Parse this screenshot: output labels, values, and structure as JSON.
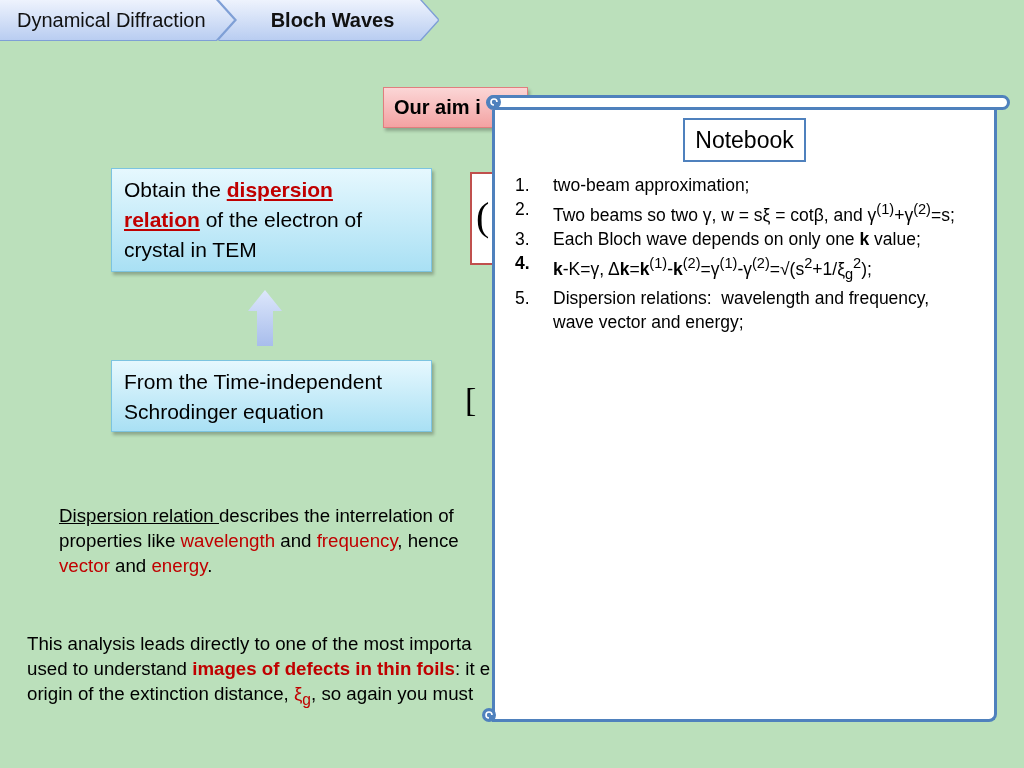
{
  "breadcrumb": [
    {
      "label": "Dynamical Diffraction",
      "selected": false
    },
    {
      "label": "Bloch Waves",
      "selected": true
    }
  ],
  "aim_box": {
    "text": "Our aim i"
  },
  "flow": {
    "goal": {
      "runs": [
        {
          "kind": "plain",
          "text": "Obtain the "
        },
        {
          "kind": "term",
          "text": "dispersion relation"
        },
        {
          "kind": "plain",
          "text": " of the electron of crystal in TEM"
        }
      ]
    },
    "source": {
      "text": "From the Time-independent Schrodinger equation"
    }
  },
  "equations": [
    {
      "kind": "boxed",
      "text": "("
    },
    {
      "kind": "plain",
      "text": "["
    }
  ],
  "paragraphs": [
    {
      "kind": "indented",
      "lines": [
        [
          {
            "kind": "underlined",
            "text": "Dispersion relation "
          },
          {
            "kind": "plain",
            "text": "describes the interrelation of"
          }
        ],
        [
          {
            "kind": "plain",
            "text": "properties like "
          },
          {
            "kind": "highlight",
            "text": "wavelength"
          },
          {
            "kind": "plain",
            "text": " and "
          },
          {
            "kind": "highlight",
            "text": "frequency"
          },
          {
            "kind": "plain",
            "text": ", hence"
          }
        ],
        [
          {
            "kind": "highlight",
            "text": "vector"
          },
          {
            "kind": "plain",
            "text": " and "
          },
          {
            "kind": "highlight",
            "text": "energy"
          },
          {
            "kind": "plain",
            "text": "."
          }
        ]
      ]
    },
    {
      "kind": "flush",
      "lines": [
        [
          {
            "kind": "plain",
            "text": "This analysis leads directly to one of the most importa"
          }
        ],
        [
          {
            "kind": "plain",
            "text": "used to understand "
          },
          {
            "kind": "strong-highlight",
            "text": "images of defects in thin foils"
          },
          {
            "kind": "plain",
            "text": ": it e"
          }
        ],
        [
          {
            "kind": "plain",
            "text": "origin of the extinction distance, "
          },
          {
            "kind": "highlight",
            "text": "ξ$_{g}$"
          },
          {
            "kind": "plain",
            "text": ", so again you must"
          }
        ]
      ]
    }
  ],
  "notebook": {
    "title": "Notebook",
    "items": [
      {
        "number": "1.",
        "bold": false,
        "text": "two-beam approximation;"
      },
      {
        "number": "2.",
        "bold": false,
        "text": "Two beams so two γ, w = sξ = cotβ, and γ$^{(1)}$+γ$^{(2)}$=s;"
      },
      {
        "number": "3.",
        "bold": false,
        "text": "Each Bloch wave depends on only one **k** value;"
      },
      {
        "number": "4.",
        "bold": true,
        "text": "**k**-K=γ, Δ**k**=**k**$^{(1)}$-**k**$^{(2)}$=γ$^{(1)}$-γ$^{(2)}$=√(s$^{2}$+1/ξ$_{g}$$^{2}$);"
      },
      {
        "number": "5.",
        "bold": false,
        "text": "Dispersion relations:  wavelength and frequency, wave vector and energy;"
      }
    ]
  }
}
